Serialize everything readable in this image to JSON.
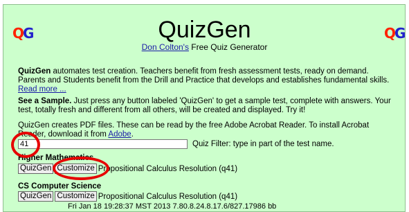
{
  "header": {
    "title": "QuizGen",
    "author_link": "Don Colton's",
    "subtitle_rest": " Free Quiz Generator",
    "logo_text": "QG"
  },
  "intro": {
    "lead": "QuizGen",
    "text": " automates test creation. Teachers benefit from fresh assessment tests, ready on demand. Parents and Students benefit from the Drill and Practice that develops and establishes fundamental skills. ",
    "read_more": "Read more ..."
  },
  "sample": {
    "lead": "See a Sample.",
    "text": " Just press any button labeled 'QuizGen' to get a sample test, complete with answers. Your test, totally fresh and different from all others, will be created and displayed. Try it!"
  },
  "pdf": {
    "text": "QuizGen creates PDF files. These can be read by the free Adobe Acrobat Reader. To install Acrobat Reader, download it from ",
    "link": "Adobe",
    "end": "."
  },
  "filter": {
    "value": "41",
    "label": "Quiz Filter: type in part of the test name."
  },
  "sections": [
    {
      "title": "Higher Mathematics",
      "quizgen_label": "QuizGen",
      "customize_label": "Customize",
      "quiz_name": "Propositional Calculus Resolution (q41)"
    },
    {
      "title": "CS Computer Science",
      "quizgen_label": "QuizGen",
      "customize_label": "Customize",
      "quiz_name": "Propositional Calculus Resolution (q41)"
    }
  ],
  "footer_line": "Fri Jan 18 19:28:37 MST 2013 7.80.8.24.8.17.6/827.17986 bb",
  "colors": {
    "background": "#ccffcc",
    "link": "#1a1aa6",
    "annotation": "#e60000"
  }
}
